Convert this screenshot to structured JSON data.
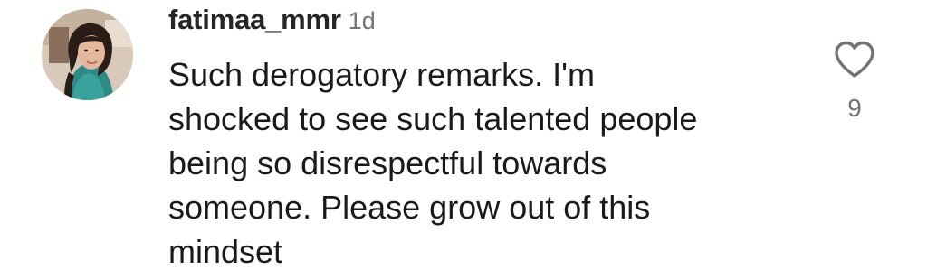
{
  "comment": {
    "username": "fatimaa_mmr",
    "timestamp": "1d",
    "text_lines": [
      "Such derogatory remarks. I'm",
      "shocked to see such talented people",
      "being so disrespectful towards",
      "someone. Please grow out of this",
      "mindset"
    ],
    "like_icon": "heart-outline-icon",
    "like_count": "9",
    "avatar": "avatar-photo"
  },
  "colors": {
    "username": "#262626",
    "body_text": "#1a1a1a",
    "secondary_text": "#737373",
    "icon_stroke": "#737373",
    "background": "#ffffff"
  }
}
